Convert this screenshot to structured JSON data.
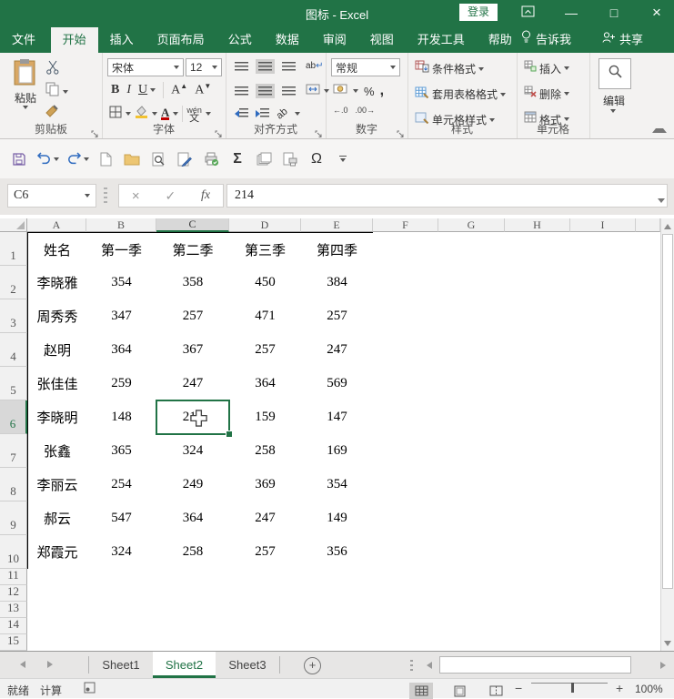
{
  "titlebar": {
    "title": "图标 - Excel",
    "sign_in": "登录"
  },
  "ribbon_tabs": {
    "file": "文件",
    "tabs": [
      "开始",
      "插入",
      "页面布局",
      "公式",
      "数据",
      "审阅",
      "视图",
      "开发工具",
      "帮助"
    ],
    "active": "开始",
    "tell_me": "告诉我",
    "share": "共享"
  },
  "ribbon": {
    "clipboard": {
      "paste": "粘贴",
      "label": "剪贴板"
    },
    "font": {
      "name": "宋体",
      "size": "12",
      "bold": "B",
      "italic": "I",
      "underline": "U",
      "color_letter": "A",
      "grow": "A",
      "shrink": "A",
      "phonetic_hint": "wén",
      "phonetic": "文",
      "label": "字体"
    },
    "alignment": {
      "wrap": "ab",
      "orient": "ab",
      "label": "对齐方式"
    },
    "number": {
      "format": "常规",
      "percent": "%",
      "comma": ",",
      "increase_decimal": "←.0",
      "decrease_decimal": ".00→",
      "label": "数字"
    },
    "styles": {
      "conditional": "条件格式",
      "format_table": "套用表格格式",
      "cell_styles": "单元格样式",
      "label": "样式"
    },
    "cells": {
      "insert": "插入",
      "delete": "删除",
      "format": "格式",
      "label": "单元格"
    },
    "editing": {
      "label": "编辑"
    }
  },
  "qat": {
    "autosum_glyph": "Σ",
    "symbol_glyph": "Ω"
  },
  "formula_bar": {
    "name_box": "C6",
    "fx": "fx",
    "formula": "214"
  },
  "grid": {
    "columns": [
      "A",
      "B",
      "C",
      "D",
      "E",
      "F",
      "G",
      "H",
      "I"
    ],
    "visible_rows": 15,
    "selection": {
      "cell": "C6",
      "column": "C",
      "row": 6
    },
    "table": {
      "headers": [
        "姓名",
        "第一季",
        "第二季",
        "第三季",
        "第四季"
      ],
      "rows": [
        [
          "李晓雅",
          "354",
          "358",
          "450",
          "384"
        ],
        [
          "周秀秀",
          "347",
          "257",
          "471",
          "257"
        ],
        [
          "赵明",
          "364",
          "367",
          "257",
          "247"
        ],
        [
          "张佳佳",
          "259",
          "247",
          "364",
          "569"
        ],
        [
          "李晓明",
          "148",
          "214",
          "159",
          "147"
        ],
        [
          "张鑫",
          "365",
          "324",
          "258",
          "169"
        ],
        [
          "李丽云",
          "254",
          "249",
          "369",
          "354"
        ],
        [
          "郝云",
          "547",
          "364",
          "247",
          "149"
        ],
        [
          "郑霞元",
          "324",
          "258",
          "257",
          "356"
        ]
      ]
    }
  },
  "sheet_bar": {
    "tabs": [
      "Sheet1",
      "Sheet2",
      "Sheet3"
    ],
    "active": "Sheet2"
  },
  "status_bar": {
    "mode": "就绪",
    "calculate": "计算",
    "zoom_level": "100%"
  }
}
